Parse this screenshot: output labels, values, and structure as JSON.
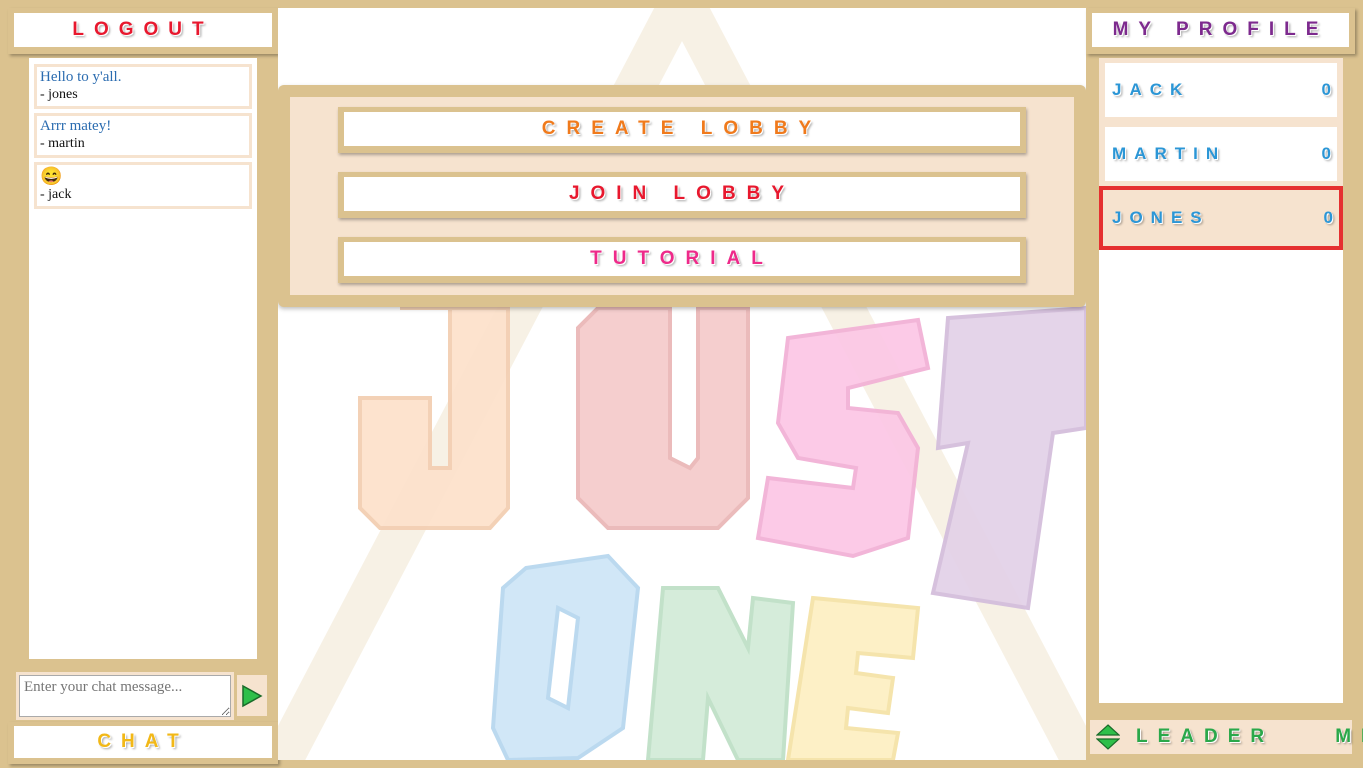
{
  "left": {
    "logout_label": "LOGOUT",
    "chat_label": "CHAT",
    "messages": [
      {
        "text": "Hello to y'all.",
        "author": "- jones"
      },
      {
        "text": "Arrr matey!",
        "author": "- martin"
      },
      {
        "text": "😄",
        "author": "- jack"
      }
    ],
    "input_placeholder": "Enter your chat message...",
    "send_icon": "play-triangle-icon"
  },
  "center": {
    "menu": {
      "create_label": "CREATE LOBBY",
      "join_label": "JOIN LOBBY",
      "tutorial_label": "TUTORIAL"
    },
    "background_logo": {
      "word1": "JUST",
      "word2": "ONE"
    }
  },
  "right": {
    "profile_label": "MY PROFILE",
    "players": [
      {
        "name": "JACK",
        "score": "0"
      },
      {
        "name": "MARTIN",
        "score": "0"
      },
      {
        "name": "JONES",
        "score": "0"
      }
    ],
    "leaderboard_label": "LEADER    ME",
    "sort_icon": "sort-up-down-icon"
  },
  "colors": {
    "frame": "#dbc28f",
    "panel": "#f6e3cf",
    "logout": "#e8182e",
    "chat": "#f2b817",
    "create": "#f07a1c",
    "join": "#e8182e",
    "tutorial": "#ee2a8a",
    "profile": "#7d2a8e",
    "player": "#2b96d6",
    "leader": "#2aa84a",
    "selected_border": "#e53030"
  }
}
